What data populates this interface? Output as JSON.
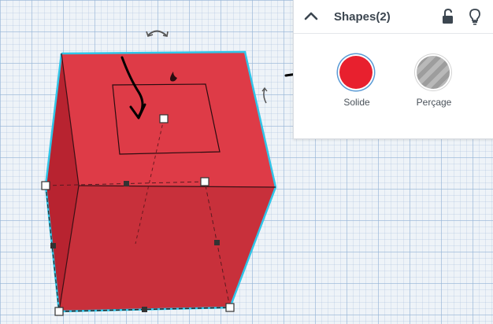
{
  "inspector": {
    "title": "Shapes(2)",
    "collapse_icon": "chevron-up-icon",
    "lock_icon": "unlock-icon",
    "light_icon": "lightbulb-icon",
    "solid_label": "Solide",
    "hole_label": "Perçage",
    "solid_color": "#e8202e"
  },
  "shape": {
    "color": "#d7323e",
    "selection_color": "#30c5e8"
  }
}
